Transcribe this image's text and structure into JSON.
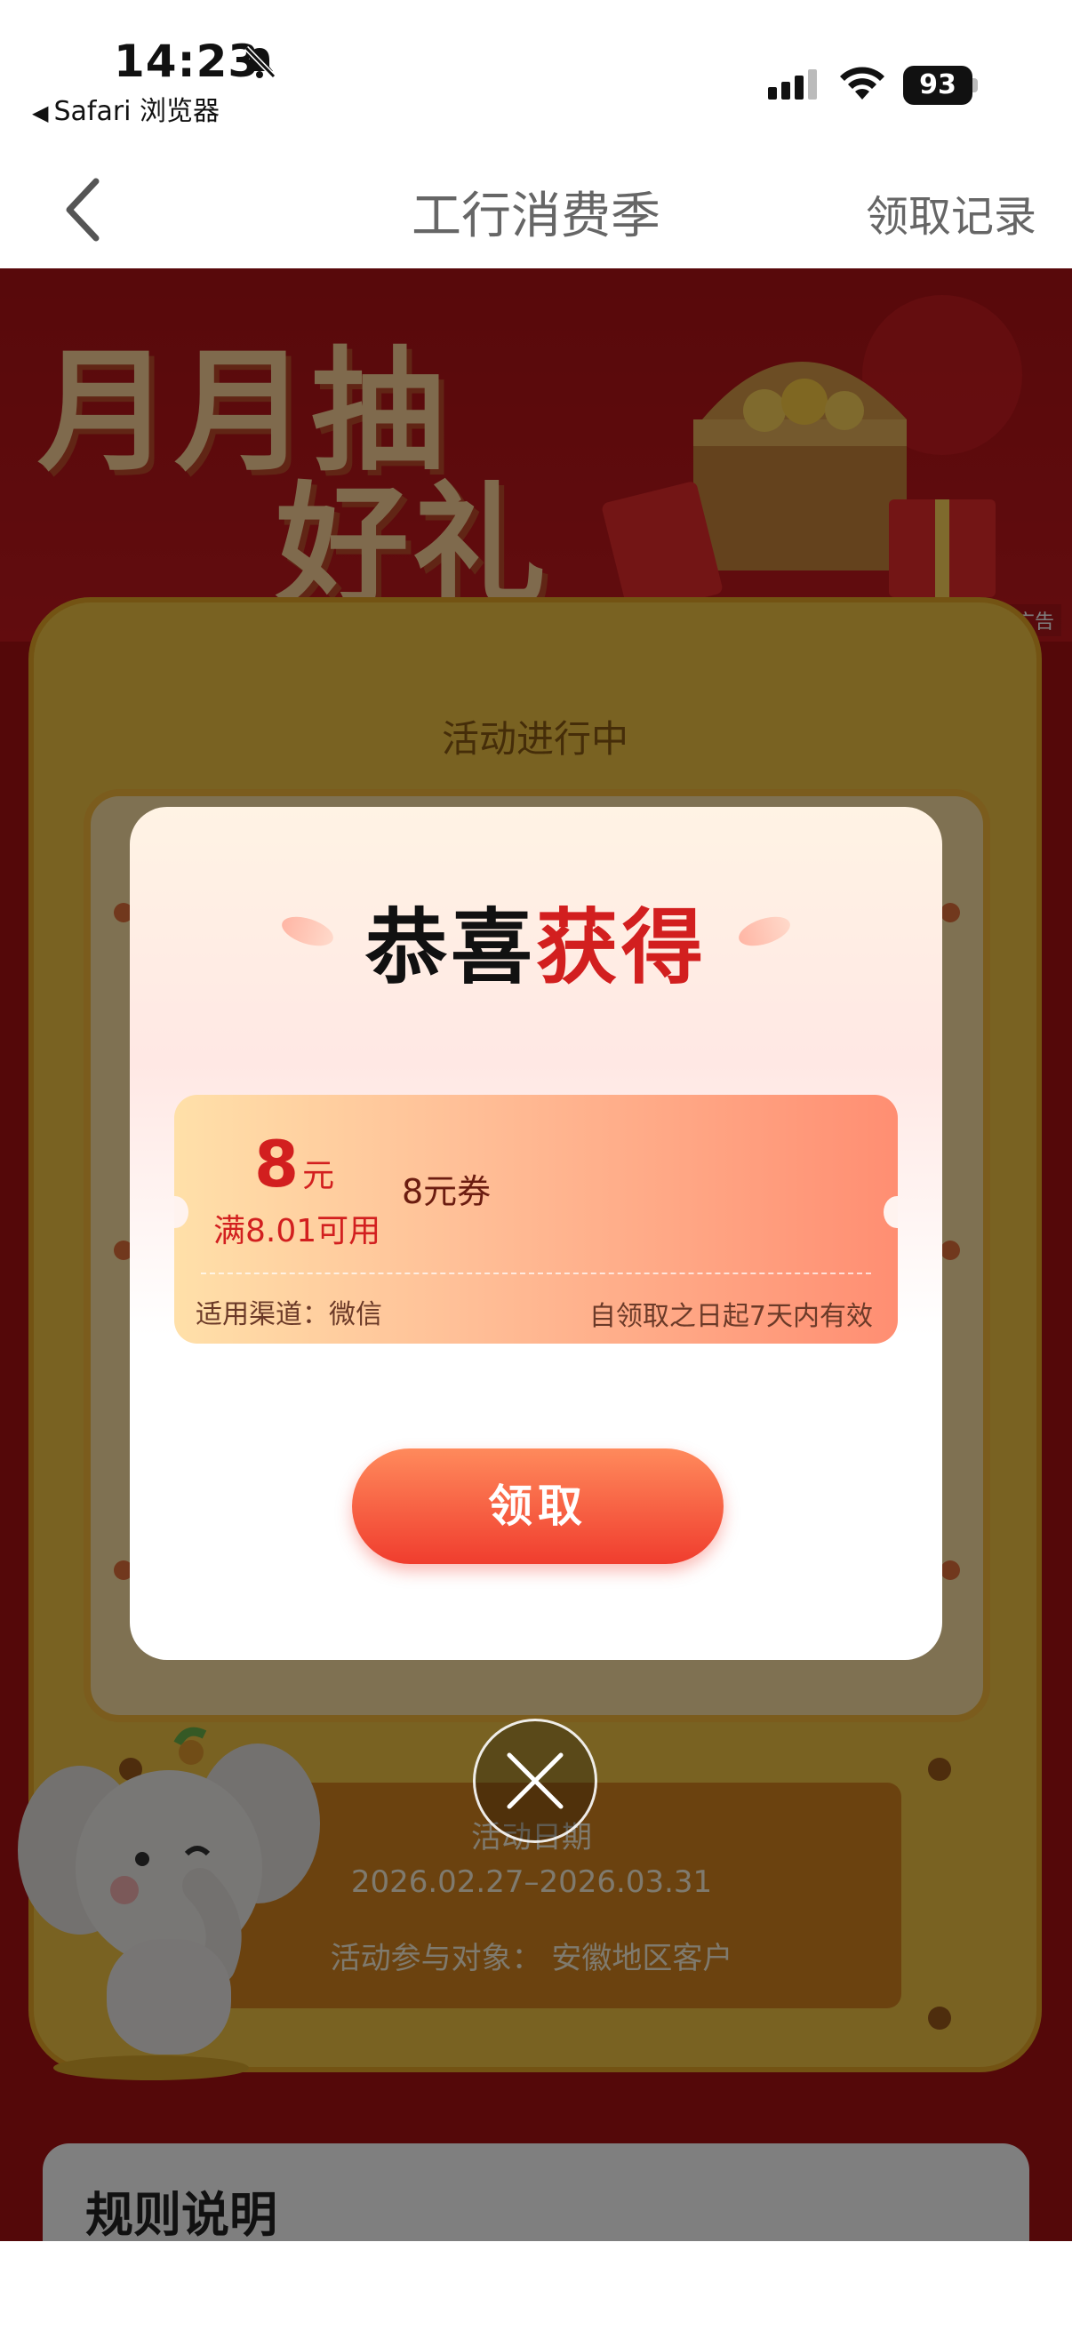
{
  "status_bar": {
    "time": "14:23",
    "back_app": "Safari 浏览器",
    "battery": "93"
  },
  "nav": {
    "title": "工行消费季",
    "record": "领取记录"
  },
  "banner": {
    "title_line1": "月月抽",
    "title_line2": "好礼",
    "ad_tag": "广告"
  },
  "activity": {
    "status": "活动进行中",
    "date_label": "活动日期",
    "dates": "2026.02.27–2026.03.31",
    "target": "活动参与对象：  安徽地区客户"
  },
  "rules": {
    "title": "规则说明"
  },
  "modal": {
    "title_a": "恭喜",
    "title_b": "获得",
    "coupon": {
      "amount": "8",
      "unit": "元",
      "condition": "满8.01可用",
      "name": "8元券",
      "channel": "适用渠道：微信",
      "validity": "自领取之日起7天内有效"
    },
    "claim_label": "领取"
  },
  "colors": {
    "accent_red": "#d21f1f",
    "button_red": "#f03d2e",
    "page_red": "#a91012"
  }
}
